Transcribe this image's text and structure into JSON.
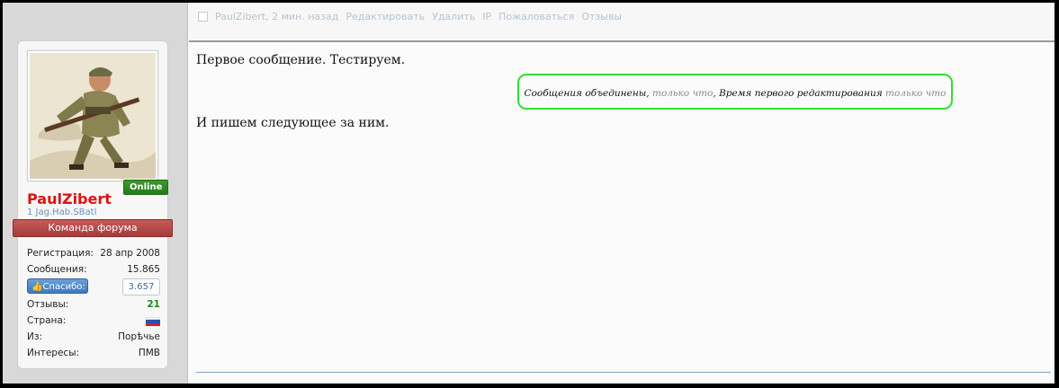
{
  "post_actions": {
    "meta": "PaulZibert, 2 мин. назад",
    "links": [
      "Редактировать",
      "Удалить",
      "IP",
      "Пожаловаться",
      "Отзывы"
    ]
  },
  "user": {
    "online_label": "Online",
    "name": "PaulZibert",
    "title": "1 Jag.Hab.SBatl",
    "ribbon": "Команда форума",
    "stats": {
      "registration_label": "Регистрация:",
      "registration_value": "28 апр 2008",
      "posts_label": "Сообщения:",
      "posts_value": "15.865",
      "thanks_button": "Спасибо:",
      "thanks_count": "3.657",
      "feedback_label": "Отзывы:",
      "feedback_value": "21",
      "country_label": "Страна:",
      "from_label": "Из:",
      "from_value": "Порѣчье",
      "interests_label": "Интересы:",
      "interests_value": "ПМВ"
    }
  },
  "post": {
    "line1": "Первое сообщение. Тестируем.",
    "merge_prefix": "Сообщения объединены, ",
    "merge_time1": "только что",
    "merge_middle": ", Время первого редактирования ",
    "merge_time2": "только что",
    "line2": "И пишем следующее за ним."
  },
  "colors": {
    "username": "#e01010",
    "online": "#2a8a1f",
    "ribbon": "#b04444",
    "merge_border": "#2fe02f",
    "thanks_button": "#4f86c9"
  }
}
